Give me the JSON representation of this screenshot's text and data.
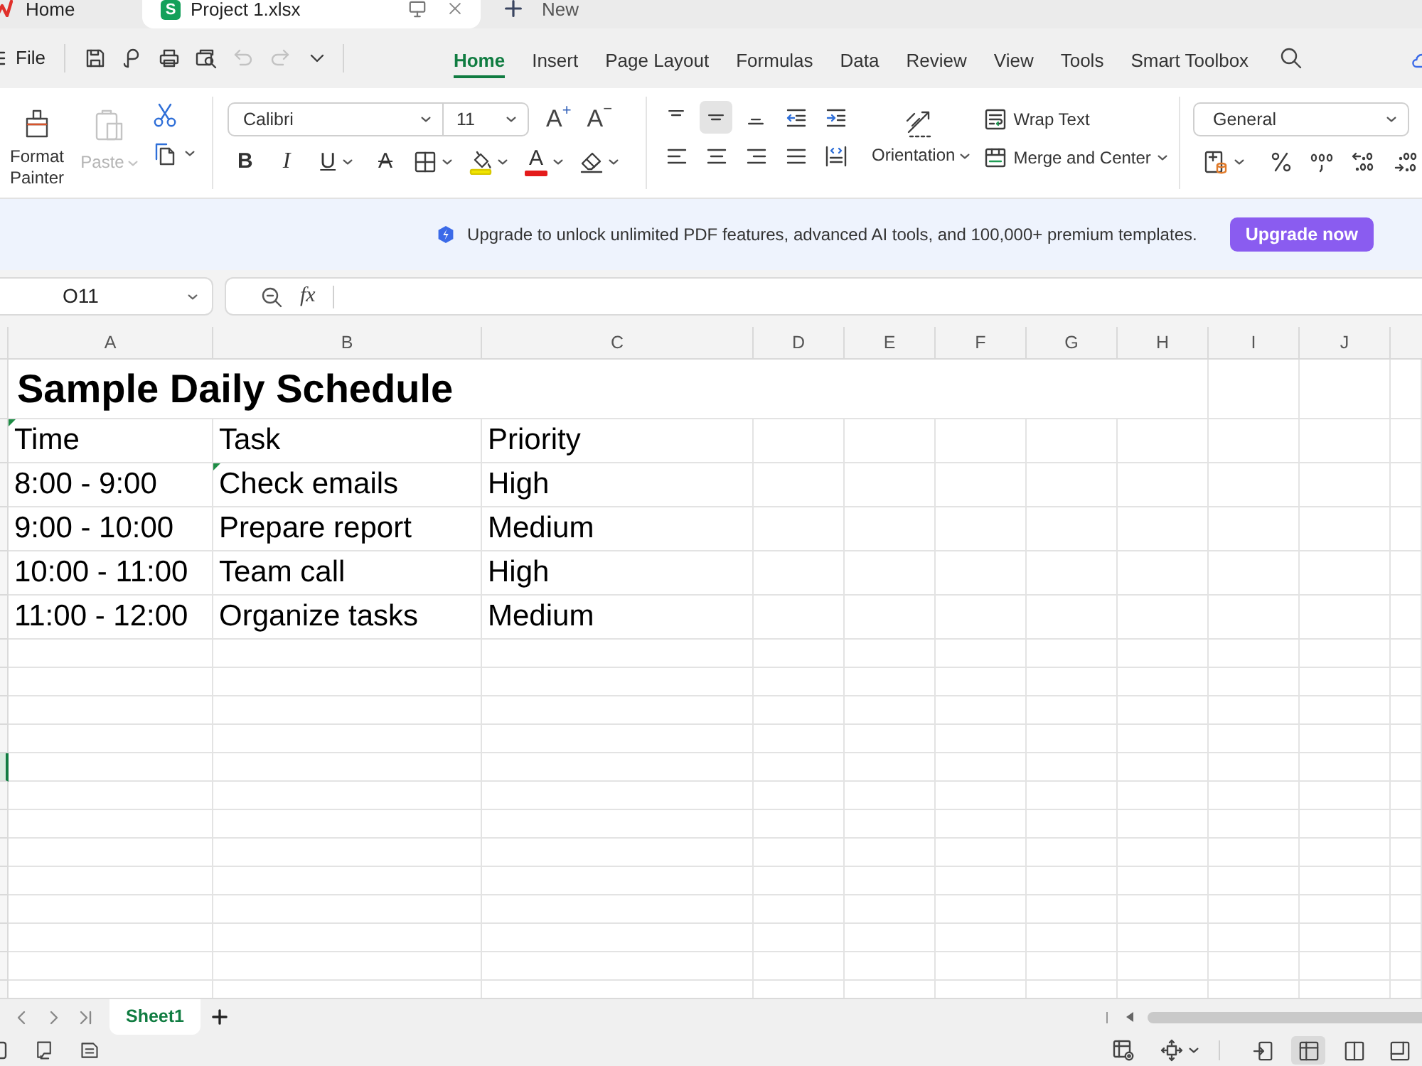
{
  "tabs": [
    {
      "kind": "home",
      "label": "Home",
      "selected": false
    },
    {
      "kind": "file",
      "label": "Project 1.xlsx",
      "logo": "S",
      "selected": true
    }
  ],
  "new_tab": "New",
  "menu": {
    "file": "File",
    "quick_access": [
      {
        "kind": "save",
        "disabled": false
      },
      {
        "kind": "export",
        "disabled": false
      },
      {
        "kind": "print",
        "disabled": false
      },
      {
        "kind": "preview",
        "disabled": false
      },
      {
        "kind": "undo",
        "disabled": true
      },
      {
        "kind": "redo",
        "disabled": true
      },
      {
        "kind": "more",
        "disabled": false
      }
    ],
    "ribbon_tabs": [
      {
        "label": "Home",
        "selected": true
      },
      {
        "label": "Insert",
        "selected": false
      },
      {
        "label": "Page Layout",
        "selected": false
      },
      {
        "label": "Formulas",
        "selected": false
      },
      {
        "label": "Data",
        "selected": false
      },
      {
        "label": "Review",
        "selected": false
      },
      {
        "label": "View",
        "selected": false
      },
      {
        "label": "Tools",
        "selected": false
      },
      {
        "label": "Smart Toolbox",
        "selected": false
      }
    ]
  },
  "ribbon": {
    "format_painter": "Format Painter",
    "paste": {
      "label": "Paste",
      "disabled": true
    },
    "font_name": "Calibri",
    "font_size": "11",
    "size_buttons": [
      {
        "kind": "grow",
        "glyph": "A",
        "sign": "+"
      },
      {
        "kind": "shrink",
        "glyph": "A",
        "sign": "−"
      }
    ],
    "style_buttons": [
      {
        "kind": "bold",
        "glyph": "B"
      },
      {
        "kind": "italic",
        "glyph": "I"
      },
      {
        "kind": "underline",
        "glyph": "U"
      },
      {
        "kind": "strikethrough",
        "glyph": "A"
      }
    ],
    "font_color": "A",
    "align_buttons": [
      {
        "kind": "top",
        "selected": false
      },
      {
        "kind": "middle",
        "selected": true
      },
      {
        "kind": "bottom",
        "selected": false
      },
      {
        "kind": "outdent",
        "selected": false
      },
      {
        "kind": "indent",
        "selected": false
      },
      {
        "kind": "left",
        "selected": false
      },
      {
        "kind": "center",
        "selected": false
      },
      {
        "kind": "right",
        "selected": false
      },
      {
        "kind": "justify",
        "selected": false
      },
      {
        "kind": "distributed",
        "selected": false
      }
    ],
    "orientation": "Orientation",
    "wrap_text": "Wrap Text",
    "merge": "Merge and Center",
    "number_format": "General"
  },
  "banner": {
    "message": "Upgrade to unlock unlimited PDF features, advanced AI tools, and 100,000+ premium templates.",
    "button": "Upgrade now"
  },
  "formula_bar": {
    "cell": "O11",
    "fx": "fx"
  },
  "sheet": {
    "columns": [
      "A",
      "B",
      "C",
      "D",
      "E",
      "F",
      "G",
      "H",
      "I",
      "J"
    ],
    "title": "Sample Daily Schedule",
    "rows": [
      {
        "selected": false,
        "cells": [
          {
            "text": "Time",
            "flagged": true
          },
          {
            "text": "Task",
            "flagged": false
          },
          {
            "text": "Priority",
            "flagged": false
          }
        ]
      },
      {
        "selected": false,
        "cells": [
          {
            "text": "8:00 - 9:00",
            "flagged": false
          },
          {
            "text": "Check emails",
            "flagged": true
          },
          {
            "text": "High",
            "flagged": false
          }
        ]
      },
      {
        "selected": false,
        "cells": [
          {
            "text": "9:00 - 10:00",
            "flagged": false
          },
          {
            "text": "Prepare report",
            "flagged": false
          },
          {
            "text": "Medium",
            "flagged": false
          }
        ]
      },
      {
        "selected": false,
        "cells": [
          {
            "text": "10:00 - 11:00",
            "flagged": false
          },
          {
            "text": "Team call",
            "flagged": false
          },
          {
            "text": "High",
            "flagged": false
          }
        ]
      },
      {
        "selected": false,
        "cells": [
          {
            "text": "11:00 - 12:00",
            "flagged": false
          },
          {
            "text": "Organize tasks",
            "flagged": false
          },
          {
            "text": "Medium",
            "flagged": false
          }
        ]
      }
    ],
    "empty_rows": [
      {
        "selected": false
      },
      {
        "selected": false
      },
      {
        "selected": false
      },
      {
        "selected": false
      },
      {
        "selected": true
      },
      {
        "selected": false
      },
      {
        "selected": false
      },
      {
        "selected": false
      },
      {
        "selected": false
      },
      {
        "selected": false
      },
      {
        "selected": false
      },
      {
        "selected": false
      },
      {
        "selected": false
      }
    ]
  },
  "sheet_tabs": [
    {
      "label": "Sheet1",
      "selected": true
    }
  ],
  "status_bar": {
    "views": [
      {
        "kind": "reading",
        "selected": false
      },
      {
        "kind": "normal",
        "selected": true
      },
      {
        "kind": "page_layout",
        "selected": false
      },
      {
        "kind": "page_break",
        "selected": false
      }
    ]
  }
}
